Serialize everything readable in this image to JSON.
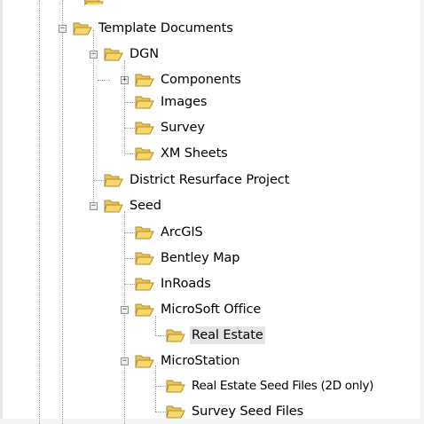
{
  "tree": {
    "nodes": [
      {
        "key": "template-documents",
        "label": "Template Documents",
        "expander": "−",
        "selected": false
      },
      {
        "key": "dgn",
        "label": "DGN",
        "expander": "−",
        "selected": false
      },
      {
        "key": "components",
        "label": "Components",
        "expander": "+",
        "selected": false
      },
      {
        "key": "images",
        "label": "Images",
        "expander": null,
        "selected": false
      },
      {
        "key": "survey",
        "label": "Survey",
        "expander": null,
        "selected": false
      },
      {
        "key": "xm-sheets",
        "label": "XM Sheets",
        "expander": null,
        "selected": false
      },
      {
        "key": "district-resurface-project",
        "label": "District Resurface Project",
        "expander": null,
        "selected": false
      },
      {
        "key": "seed",
        "label": "Seed",
        "expander": "−",
        "selected": false
      },
      {
        "key": "arcgis",
        "label": "ArcGIS",
        "expander": null,
        "selected": false
      },
      {
        "key": "bentley-map",
        "label": "Bentley Map",
        "expander": null,
        "selected": false
      },
      {
        "key": "inroads",
        "label": "InRoads",
        "expander": null,
        "selected": false
      },
      {
        "key": "microsoft-office",
        "label": "MicroSoft Office",
        "expander": "−",
        "selected": false
      },
      {
        "key": "real-estate",
        "label": "Real Estate",
        "expander": null,
        "selected": true
      },
      {
        "key": "microstation",
        "label": "MicroStation",
        "expander": "−",
        "selected": false
      },
      {
        "key": "real-estate-seed-files",
        "label": "Real Estate Seed Files (2D only)",
        "expander": null,
        "selected": false
      },
      {
        "key": "survey-seed-files",
        "label": "Survey Seed Files",
        "expander": null,
        "selected": false
      }
    ]
  },
  "colors": {
    "selection_background": "#e5e5e5",
    "folder_fill": "#f5d76e",
    "folder_outline": "#b48c28",
    "tree_lines": "#a0a0a0"
  },
  "icons": {
    "folder": "open-folder-icon",
    "expand": "plus-box-icon",
    "collapse": "minus-box-icon"
  }
}
